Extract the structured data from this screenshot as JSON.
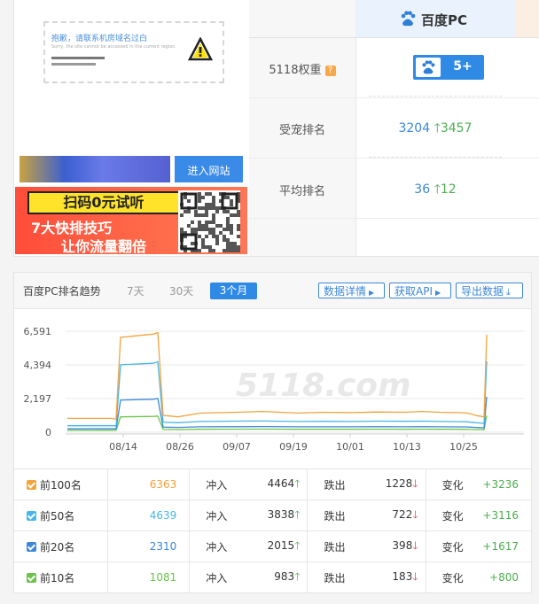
{
  "top": {
    "placeholder": {
      "line1": "抱歉，请联系机房域名过白",
      "line2": "Sorry, the site cannot be accessed in the current region."
    },
    "banner_button": "进入网站",
    "ad": {
      "tag": "扫码0元试听",
      "line2": "7大快排技巧",
      "line3": "让你流量翻倍"
    },
    "engine_title": "百度PC",
    "rows": {
      "weight_label": "5118权重",
      "weight_value": "5+",
      "favored_label": "受宠排名",
      "favored_value": "3204",
      "favored_change": "3457",
      "avg_label": "平均排名",
      "avg_value": "36",
      "avg_change": "12"
    }
  },
  "trend": {
    "title": "百度PC排名趋势",
    "tabs": [
      "7天",
      "30天",
      "3个月"
    ],
    "buttons": [
      "数据详情",
      "获取API",
      "导出数据"
    ],
    "watermark": "5118.com"
  },
  "chart_data": {
    "type": "line",
    "y_ticks": [
      "6,591",
      "4,394",
      "2,197",
      "0"
    ],
    "ylim": [
      0,
      6591
    ],
    "x_ticks": [
      "08/14",
      "08/26",
      "09/07",
      "09/19",
      "10/01",
      "10/13",
      "10/25"
    ],
    "x_range": [
      "08/04",
      "10/31"
    ],
    "series": [
      {
        "name": "前100名",
        "color": "#f4a23b",
        "values": [
          900,
          900,
          880,
          870,
          900,
          6200,
          6400,
          6500,
          1100,
          1000,
          1250,
          1300,
          1350,
          1250,
          1300,
          1280,
          1320,
          1300,
          1350,
          1300,
          1280,
          1250,
          1200,
          1100,
          1050,
          1000,
          6363
        ]
      },
      {
        "name": "前50名",
        "color": "#47b6e8",
        "values": [
          420,
          430,
          420,
          420,
          430,
          4400,
          4500,
          4600,
          650,
          620,
          700,
          720,
          730,
          700,
          710,
          700,
          720,
          710,
          720,
          700,
          690,
          680,
          650,
          620,
          600,
          580,
          4639
        ]
      },
      {
        "name": "前20名",
        "color": "#3d87d6",
        "values": [
          220,
          230,
          220,
          220,
          230,
          2100,
          2150,
          2200,
          330,
          310,
          350,
          360,
          370,
          350,
          355,
          350,
          360,
          355,
          360,
          350,
          345,
          340,
          330,
          310,
          300,
          290,
          2310
        ]
      },
      {
        "name": "前10名",
        "color": "#6cc24a",
        "values": [
          120,
          125,
          120,
          120,
          125,
          1000,
          1030,
          1050,
          180,
          170,
          190,
          195,
          200,
          190,
          192,
          190,
          195,
          192,
          195,
          190,
          188,
          185,
          180,
          170,
          165,
          160,
          1081
        ]
      }
    ]
  },
  "stats": [
    {
      "label": "前100名",
      "color": "#f4a23b",
      "value": "6363",
      "in_label": "冲入",
      "in": "4464",
      "out_label": "跌出",
      "out": "1228",
      "chg_label": "变化",
      "chg": "+3236"
    },
    {
      "label": "前50名",
      "color": "#47b6e8",
      "value": "4639",
      "in_label": "冲入",
      "in": "3838",
      "out_label": "跌出",
      "out": "722",
      "chg_label": "变化",
      "chg": "+3116"
    },
    {
      "label": "前20名",
      "color": "#3d87d6",
      "value": "2310",
      "in_label": "冲入",
      "in": "2015",
      "out_label": "跌出",
      "out": "398",
      "chg_label": "变化",
      "chg": "+1617"
    },
    {
      "label": "前10名",
      "color": "#6cc24a",
      "value": "1081",
      "in_label": "冲入",
      "in": "983",
      "out_label": "跌出",
      "out": "183",
      "chg_label": "变化",
      "chg": "+800"
    }
  ]
}
